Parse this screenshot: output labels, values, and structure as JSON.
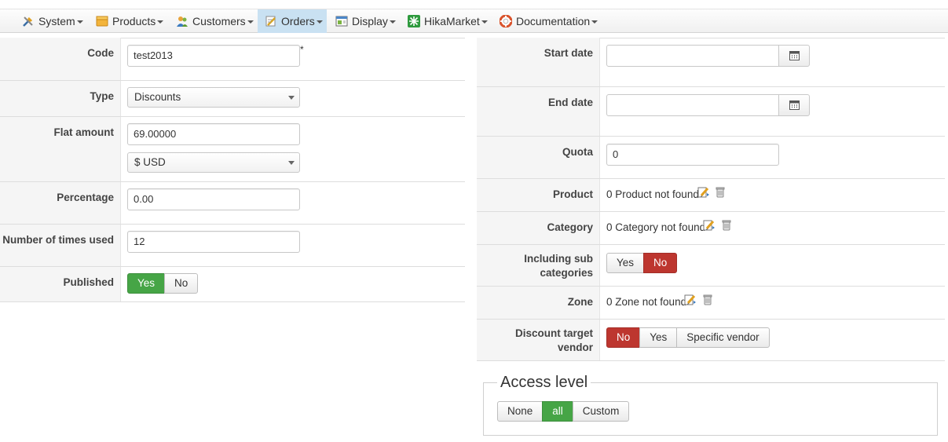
{
  "menu": {
    "items": [
      {
        "label": "System",
        "icon": "tools-icon"
      },
      {
        "label": "Products",
        "icon": "box-icon"
      },
      {
        "label": "Customers",
        "icon": "users-icon"
      },
      {
        "label": "Orders",
        "icon": "orders-icon",
        "active": true
      },
      {
        "label": "Display",
        "icon": "display-icon"
      },
      {
        "label": "HikaMarket",
        "icon": "hikamarket-icon"
      },
      {
        "label": "Documentation",
        "icon": "lifebuoy-icon"
      }
    ]
  },
  "left": {
    "code": {
      "label": "Code",
      "value": "test2013",
      "required_mark": "*"
    },
    "type": {
      "label": "Type",
      "value": "Discounts"
    },
    "flat_amount": {
      "label": "Flat amount",
      "value": "69.00000",
      "currency": "$ USD"
    },
    "percentage": {
      "label": "Percentage",
      "value": "0.00"
    },
    "times_used": {
      "label": "Number of times used",
      "value": "12"
    },
    "published": {
      "label": "Published",
      "yes": "Yes",
      "no": "No",
      "selected": "Yes"
    }
  },
  "right": {
    "start_date": {
      "label": "Start date",
      "value": ""
    },
    "end_date": {
      "label": "End date",
      "value": ""
    },
    "quota": {
      "label": "Quota",
      "value": "0"
    },
    "product": {
      "label": "Product",
      "text": "0 Product not found"
    },
    "category": {
      "label": "Category",
      "text": "0 Category not found"
    },
    "subcats": {
      "label_line1": "Including sub",
      "label_line2": "categories",
      "yes": "Yes",
      "no": "No",
      "selected": "No"
    },
    "zone": {
      "label": "Zone",
      "text": "0 Zone not found"
    },
    "vendor": {
      "label_line1": "Discount target",
      "label_line2": "vendor",
      "no": "No",
      "yes": "Yes",
      "specific": "Specific vendor",
      "selected": "No"
    }
  },
  "access": {
    "legend": "Access level",
    "none": "None",
    "all": "all",
    "custom": "Custom",
    "selected": "all"
  },
  "colors": {
    "green": "#46a546",
    "red": "#bd362f",
    "active_menu": "#c9e1f2"
  }
}
